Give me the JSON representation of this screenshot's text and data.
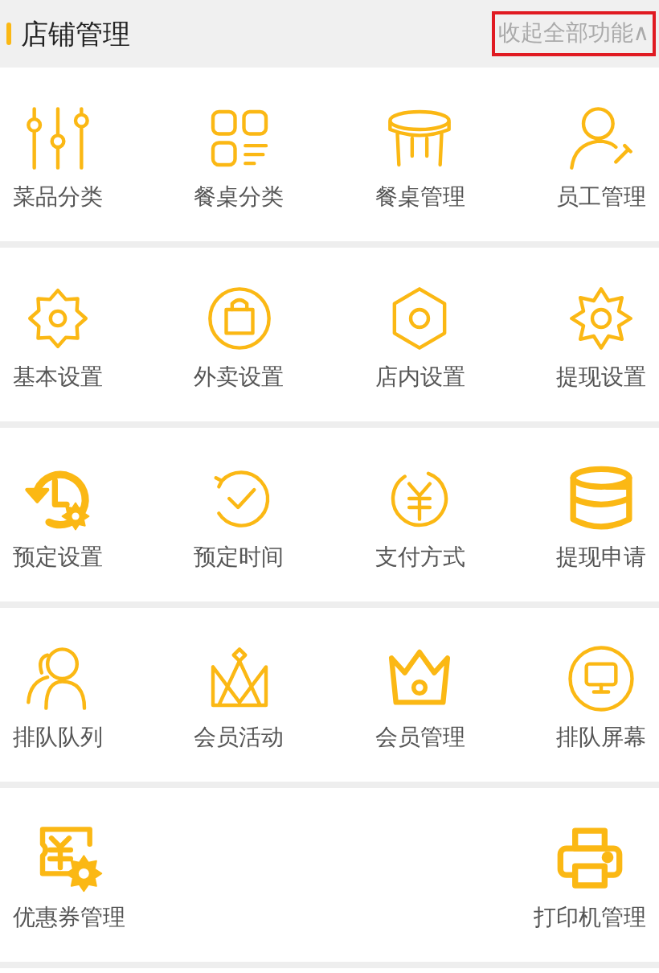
{
  "header": {
    "title": "店铺管理",
    "collapse_link": "收起全部功能∧"
  },
  "rows": [
    {
      "items": [
        {
          "label": "菜品分类"
        },
        {
          "label": "餐桌分类"
        },
        {
          "label": "餐桌管理"
        },
        {
          "label": "员工管理"
        }
      ]
    },
    {
      "items": [
        {
          "label": "基本设置"
        },
        {
          "label": "外卖设置"
        },
        {
          "label": "店内设置"
        },
        {
          "label": "提现设置"
        }
      ]
    },
    {
      "items": [
        {
          "label": "预定设置"
        },
        {
          "label": "预定时间"
        },
        {
          "label": "支付方式"
        },
        {
          "label": "提现申请"
        }
      ]
    },
    {
      "items": [
        {
          "label": "排队队列"
        },
        {
          "label": "会员活动"
        },
        {
          "label": "会员管理"
        },
        {
          "label": "排队屏幕"
        }
      ]
    },
    {
      "items": [
        {
          "label": "优惠券管理"
        },
        {
          "label": "打印机管理"
        }
      ]
    }
  ]
}
